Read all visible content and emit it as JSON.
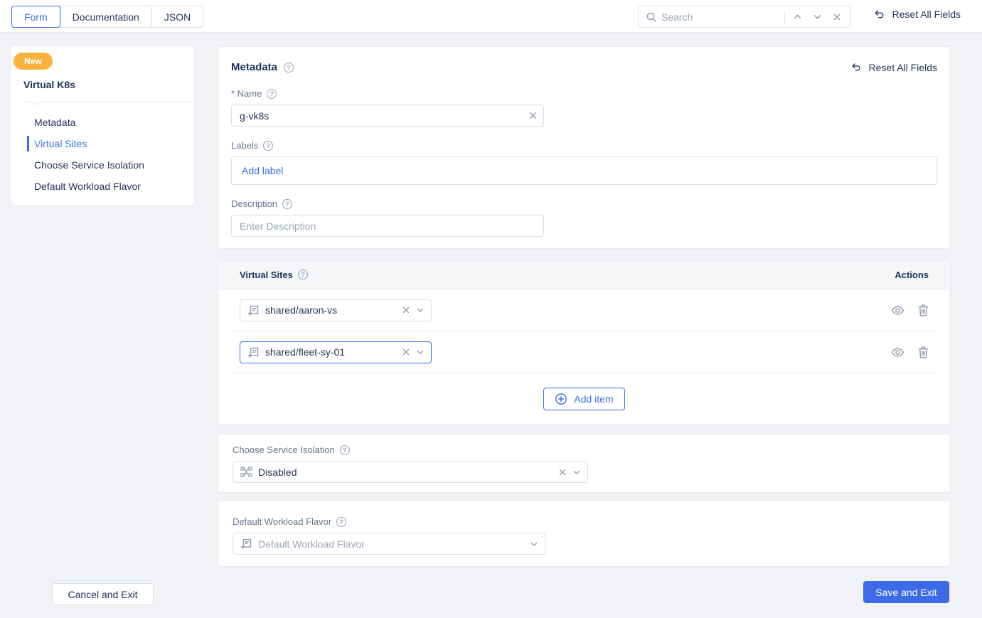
{
  "topbar": {
    "tabs": [
      {
        "label": "Form"
      },
      {
        "label": "Documentation"
      },
      {
        "label": "JSON"
      }
    ],
    "active_tab": "Form",
    "search_placeholder": "Search",
    "reset_all_fields": "Reset All Fields"
  },
  "sidebar": {
    "badge": "New",
    "title": "Virtual K8s",
    "items": [
      {
        "label": "Metadata"
      },
      {
        "label": "Virtual Sites"
      },
      {
        "label": "Choose Service Isolation"
      },
      {
        "label": "Default Workload Flavor"
      }
    ],
    "active_item": "Virtual Sites"
  },
  "metadata": {
    "title": "Metadata",
    "reset_all_fields": "Reset All Fields",
    "name": {
      "label": "* Name",
      "value": "g-vk8s"
    },
    "labels": {
      "label": "Labels",
      "add_label": "Add label"
    },
    "description": {
      "label": "Description",
      "placeholder": "Enter Description"
    }
  },
  "virtual_sites": {
    "title": "Virtual Sites",
    "actions_header": "Actions",
    "rows": [
      {
        "value": "shared/aaron-vs"
      },
      {
        "value": "shared/fleet-sy-01"
      }
    ],
    "focused_row": "shared/fleet-sy-01",
    "add_item": "Add item"
  },
  "service_isolation": {
    "label": "Choose Service Isolation",
    "value": "Disabled"
  },
  "workload_flavor": {
    "label": "Default Workload Flavor",
    "placeholder": "Default Workload Flavor"
  },
  "footer": {
    "cancel": "Cancel and Exit",
    "save": "Save and Exit"
  },
  "colors": {
    "accent_blue": "#3a6ce8",
    "save_button_blue": "#3d6be8",
    "badge_orange": "#f9b33d",
    "navy_text": "#22355c",
    "label_gray": "#64748f",
    "icon_gray": "#8d99ad",
    "page_background": "#f0f2f5",
    "table_header_background": "#f4f6f8"
  },
  "icons": {
    "search-icon": "magnifier",
    "chevron-up-icon": "caret-up",
    "chevron-down-icon": "caret-down",
    "close-icon": "x",
    "reset-icon": "undo-arrow",
    "help-icon": "question-circle",
    "reference-icon": "document-with-plus",
    "eye-icon": "show-preview",
    "trash-icon": "delete",
    "add-circle-icon": "plus-circle",
    "service-isolation-icon": "network-nodes"
  }
}
